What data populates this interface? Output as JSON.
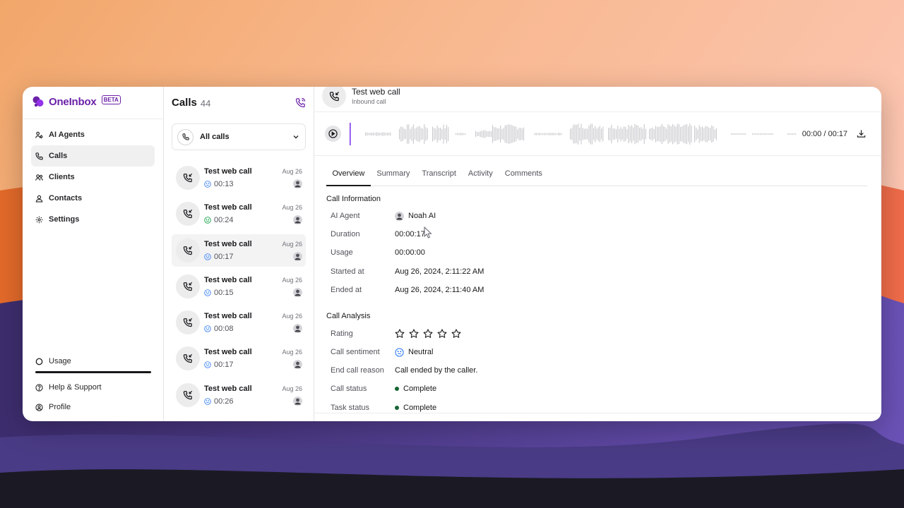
{
  "app": {
    "name": "OneInbox",
    "badge": "BETA",
    "brand_color": "#6b21a8"
  },
  "sidebar": {
    "items": [
      {
        "label": "AI Agents",
        "icon": "users-gear-icon"
      },
      {
        "label": "Calls",
        "icon": "phone-icon",
        "active": true
      },
      {
        "label": "Clients",
        "icon": "clients-icon"
      },
      {
        "label": "Contacts",
        "icon": "contact-icon"
      },
      {
        "label": "Settings",
        "icon": "gear-icon"
      }
    ],
    "bottom": {
      "usage": "Usage",
      "help": "Help & Support",
      "profile": "Profile"
    }
  },
  "calls": {
    "title": "Calls",
    "count": "44",
    "filter": "All calls",
    "items": [
      {
        "title": "Test web call",
        "duration": "00:13",
        "date": "Aug 26",
        "sentiment": "neutral"
      },
      {
        "title": "Test web call",
        "duration": "00:24",
        "date": "Aug 26",
        "sentiment": "positive"
      },
      {
        "title": "Test web call",
        "duration": "00:17",
        "date": "Aug 26",
        "sentiment": "neutral",
        "active": true
      },
      {
        "title": "Test web call",
        "duration": "00:15",
        "date": "Aug 26",
        "sentiment": "neutral"
      },
      {
        "title": "Test web call",
        "duration": "00:08",
        "date": "Aug 26",
        "sentiment": "neutral"
      },
      {
        "title": "Test web call",
        "duration": "00:17",
        "date": "Aug 26",
        "sentiment": "neutral"
      },
      {
        "title": "Test web call",
        "duration": "00:26",
        "date": "Aug 26",
        "sentiment": "neutral"
      }
    ]
  },
  "detail": {
    "title": "Test web call",
    "subtitle": "Inbound call",
    "player": {
      "time": "00:00 / 00:17",
      "progress": 0
    },
    "tabs": [
      "Overview",
      "Summary",
      "Transcript",
      "Activity",
      "Comments"
    ],
    "call_information": {
      "title": "Call Information",
      "rows": [
        {
          "label": "AI Agent",
          "value": "Noah AI"
        },
        {
          "label": "Duration",
          "value": "00:00:17"
        },
        {
          "label": "Usage",
          "value": "00:00:00"
        },
        {
          "label": "Started at",
          "value": "Aug 26, 2024, 2:11:22 AM"
        },
        {
          "label": "Ended at",
          "value": "Aug 26, 2024, 2:11:40 AM"
        }
      ]
    },
    "call_analysis": {
      "title": "Call Analysis",
      "rating_label": "Rating",
      "rating": 0,
      "rating_max": 5,
      "sentiment_label": "Call sentiment",
      "sentiment": "Neutral",
      "end_reason_label": "End call reason",
      "end_reason": "Call ended by the caller.",
      "call_status_label": "Call status",
      "call_status": "Complete",
      "task_status_label": "Task status",
      "task_status": "Complete",
      "status_color": "#166534"
    }
  }
}
